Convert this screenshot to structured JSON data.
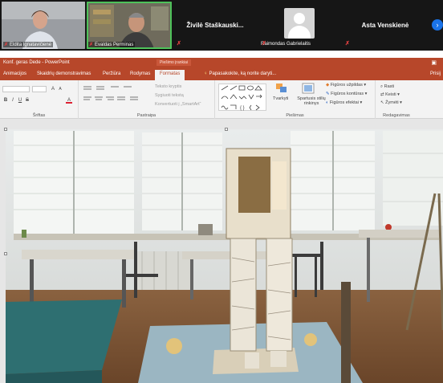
{
  "video_call": {
    "participants": [
      {
        "name": "Eldita Ignatavičienė",
        "muted": true
      },
      {
        "name": "Evaldas Perminas",
        "muted": true,
        "active": true
      },
      {
        "name": "Živilė Staškauski...",
        "muted": true
      },
      {
        "name": "Raimondas Gabrielaitis",
        "muted": true
      },
      {
        "name": "Asta Venskienė",
        "muted": true
      }
    ],
    "mute_glyph": "✗",
    "next_glyph": "›"
  },
  "powerpoint": {
    "window_title": "Konf. geras Dede - PowerPoint",
    "contextual_tab": "Piešimo įrankiai",
    "window_control": "▣",
    "tabs": [
      {
        "label": "Animacijos",
        "selected": false
      },
      {
        "label": "Skaidrių demonstravimas",
        "selected": false
      },
      {
        "label": "Peržiūra",
        "selected": false
      },
      {
        "label": "Rodymas",
        "selected": false
      },
      {
        "label": "Formatas",
        "selected": true
      }
    ],
    "tell_me": "Papasakokite, ką norite daryti...",
    "share_partial": "Prisij"
  },
  "ribbon": {
    "groups": {
      "font": "Šriftas",
      "paragraph": "Pastraipa",
      "drawing": "Piešimas",
      "editing": "Redagavimas"
    },
    "paragraph_buttons": {
      "text_direction": "Teksto kryptis",
      "align_text": "Sygiuoti tekstą",
      "convert_smartart": "Konvertuoti į „SmartArt“"
    },
    "drawing_buttons": {
      "arrange": "Tvarkyti",
      "quick_styles": "Spartusis stilių rinkinys",
      "shape_fill": "Figūros užpildas",
      "shape_outline": "Figūros kontūras",
      "shape_effects": "Figūros efektai"
    },
    "editing_buttons": {
      "find": "Rasti",
      "replace": "Keisti",
      "select": "Žymėti"
    },
    "glyphs": {
      "bold": "B",
      "italic": "I",
      "font_grow": "A",
      "dropdown": "▾",
      "search": "⌕",
      "bulb": "♀"
    }
  },
  "slide": {
    "description_visible": false
  }
}
